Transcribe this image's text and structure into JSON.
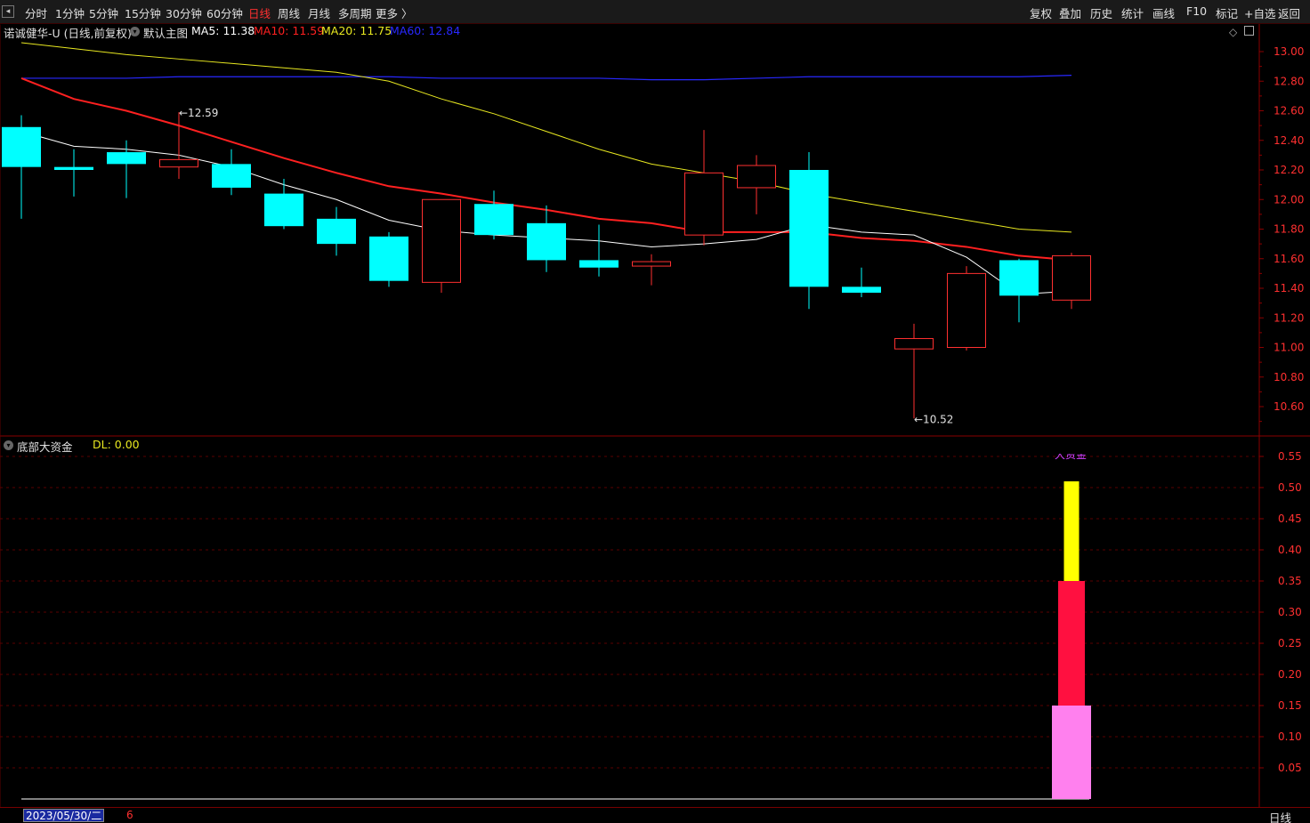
{
  "toolbar": {
    "left_tabs": [
      "分时",
      "1分钟",
      "5分钟",
      "15分钟",
      "30分钟",
      "60分钟",
      "日线",
      "周线",
      "月线",
      "多周期",
      "更多 〉"
    ],
    "active_tab": "日线",
    "right_tools": [
      "复权",
      "叠加",
      "历史",
      "统计",
      "画线",
      "F10",
      "标记",
      "+自选",
      "返回"
    ]
  },
  "main_panel": {
    "stock_title": "诺诚健华-U (日线,前复权)",
    "template_label": "默认主图",
    "ma": [
      {
        "label": "MA5: 11.38",
        "color": "#ffffff"
      },
      {
        "label": "MA10: 11.59",
        "color": "#ff2020"
      },
      {
        "label": "MA20: 11.75",
        "color": "#e8e820"
      },
      {
        "label": "MA60: 12.84",
        "color": "#2828ff"
      }
    ],
    "y_ticks": [
      "13.00",
      "12.80",
      "12.60",
      "12.40",
      "12.20",
      "12.00",
      "11.80",
      "11.60",
      "11.40",
      "11.20",
      "11.00",
      "10.80",
      "10.60"
    ],
    "high_marker": "12.59",
    "low_marker": "10.52"
  },
  "indicator_panel": {
    "name": "底部大资金",
    "value_label": "DL: 0.00",
    "y_ticks": [
      "0.55",
      "0.50",
      "0.45",
      "0.40",
      "0.35",
      "0.30",
      "0.25",
      "0.20",
      "0.15",
      "0.10",
      "0.05"
    ],
    "bar_colors": {
      "segment1": "#ff80ee",
      "segment2": "#ff1040",
      "segment3": "#ffff00"
    },
    "bar_caption": "大资金"
  },
  "chart_data": {
    "type": "candlestick",
    "ylim": [
      10.45,
      13.12
    ],
    "candles": [
      {
        "o": 12.22,
        "h": 12.57,
        "l": 11.87,
        "c": 12.49,
        "up": false
      },
      {
        "o": 12.22,
        "h": 12.34,
        "l": 12.02,
        "c": 12.2,
        "up": false
      },
      {
        "o": 12.32,
        "h": 12.4,
        "l": 12.01,
        "c": 12.24,
        "up": false
      },
      {
        "o": 12.22,
        "h": 12.59,
        "l": 12.14,
        "c": 12.27,
        "up": true
      },
      {
        "o": 12.24,
        "h": 12.34,
        "l": 12.03,
        "c": 12.08,
        "up": false
      },
      {
        "o": 12.04,
        "h": 12.14,
        "l": 11.8,
        "c": 11.82,
        "up": false
      },
      {
        "o": 11.87,
        "h": 11.95,
        "l": 11.62,
        "c": 11.7,
        "up": false
      },
      {
        "o": 11.75,
        "h": 11.78,
        "l": 11.41,
        "c": 11.45,
        "up": false
      },
      {
        "o": 11.44,
        "h": 12.0,
        "l": 11.37,
        "c": 12.0,
        "up": true
      },
      {
        "o": 11.97,
        "h": 12.06,
        "l": 11.73,
        "c": 11.76,
        "up": false
      },
      {
        "o": 11.84,
        "h": 11.96,
        "l": 11.51,
        "c": 11.59,
        "up": false
      },
      {
        "o": 11.59,
        "h": 11.83,
        "l": 11.48,
        "c": 11.54,
        "up": false
      },
      {
        "o": 11.55,
        "h": 11.63,
        "l": 11.42,
        "c": 11.58,
        "up": true
      },
      {
        "o": 11.76,
        "h": 12.47,
        "l": 11.69,
        "c": 12.18,
        "up": true
      },
      {
        "o": 12.08,
        "h": 12.3,
        "l": 11.9,
        "c": 12.23,
        "up": true
      },
      {
        "o": 12.2,
        "h": 12.32,
        "l": 11.26,
        "c": 11.41,
        "up": false
      },
      {
        "o": 11.41,
        "h": 11.54,
        "l": 11.34,
        "c": 11.37,
        "up": false
      },
      {
        "o": 10.99,
        "h": 11.16,
        "l": 10.52,
        "c": 11.06,
        "up": true
      },
      {
        "o": 11.0,
        "h": 11.55,
        "l": 10.98,
        "c": 11.5,
        "up": true
      },
      {
        "o": 11.59,
        "h": 11.6,
        "l": 11.17,
        "c": 11.35,
        "up": false
      },
      {
        "o": 11.32,
        "h": 11.64,
        "l": 11.26,
        "c": 11.62,
        "up": true
      }
    ],
    "ma5": [
      12.46,
      12.36,
      12.34,
      12.3,
      12.22,
      12.1,
      12.0,
      11.86,
      11.79,
      11.76,
      11.74,
      11.72,
      11.68,
      11.7,
      11.73,
      11.83,
      11.78,
      11.76,
      11.61,
      11.36,
      11.38
    ],
    "ma10": [
      12.82,
      12.68,
      12.6,
      12.5,
      12.39,
      12.28,
      12.18,
      12.09,
      12.04,
      11.98,
      11.93,
      11.87,
      11.84,
      11.78,
      11.78,
      11.78,
      11.74,
      11.72,
      11.68,
      11.62,
      11.59
    ],
    "ma20": [
      13.06,
      13.02,
      12.98,
      12.95,
      12.92,
      12.89,
      12.86,
      12.8,
      12.68,
      12.58,
      12.46,
      12.34,
      12.24,
      12.18,
      12.12,
      12.04,
      11.98,
      11.92,
      11.86,
      11.8,
      11.78,
      11.75
    ],
    "ma60": [
      12.82,
      12.82,
      12.82,
      12.83,
      12.83,
      12.83,
      12.83,
      12.83,
      12.82,
      12.82,
      12.82,
      12.82,
      12.81,
      12.81,
      12.82,
      12.83,
      12.83,
      12.83,
      12.83,
      12.83,
      12.84
    ],
    "indicator": {
      "ylim": [
        0,
        0.58
      ],
      "segments": [
        0.15,
        0.35,
        0.51
      ]
    }
  },
  "status": {
    "date": "2023/05/30/二",
    "date_suffix": "6",
    "period": "日线"
  }
}
